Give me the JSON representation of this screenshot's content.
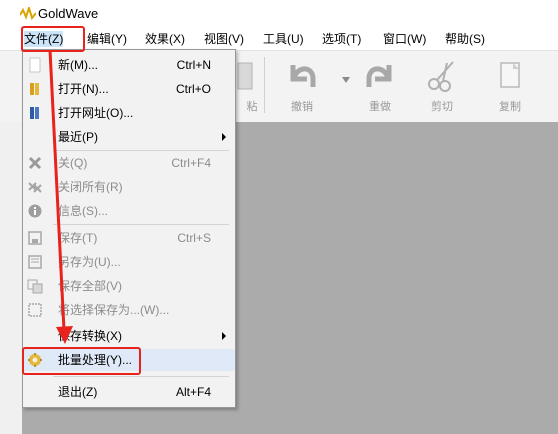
{
  "window": {
    "title": "GoldWave"
  },
  "menubar": {
    "items": [
      {
        "label": "文件(Z)"
      },
      {
        "label": "编辑(Y)"
      },
      {
        "label": "效果(X)"
      },
      {
        "label": "视图(V)"
      },
      {
        "label": "工具(U)"
      },
      {
        "label": "选项(T)"
      },
      {
        "label": "窗口(W)"
      },
      {
        "label": "帮助(S)"
      }
    ]
  },
  "toolbar": {
    "partial_label": "粘",
    "buttons": [
      {
        "label": "撤销",
        "icon": "undo-icon"
      },
      {
        "label": "重做",
        "icon": "redo-icon"
      },
      {
        "label": "剪切",
        "icon": "cut-icon"
      },
      {
        "label": "复制",
        "icon": "copy-icon"
      }
    ]
  },
  "file_menu": {
    "items": [
      {
        "label": "新(M)...",
        "shortcut": "Ctrl+N",
        "icon": "new-file-icon",
        "enabled": true
      },
      {
        "label": "打开(N)...",
        "shortcut": "Ctrl+O",
        "icon": "open-file-icon",
        "enabled": true
      },
      {
        "label": "打开网址(O)...",
        "shortcut": "",
        "icon": "open-url-icon",
        "enabled": true
      },
      {
        "label": "最近(P)",
        "shortcut": "",
        "submenu": true,
        "enabled": true
      },
      {
        "label": "关(Q)",
        "shortcut": "Ctrl+F4",
        "icon": "close-icon",
        "enabled": false
      },
      {
        "label": "关闭所有(R)",
        "shortcut": "",
        "icon": "close-all-icon",
        "enabled": false
      },
      {
        "label": "信息(S)...",
        "shortcut": "",
        "icon": "info-icon",
        "enabled": false
      },
      {
        "label": "保存(T)",
        "shortcut": "Ctrl+S",
        "icon": "save-icon",
        "enabled": false
      },
      {
        "label": "另存为(U)...",
        "shortcut": "",
        "icon": "save-as-icon",
        "enabled": false
      },
      {
        "label": "保存全部(V)",
        "shortcut": "",
        "icon": "save-all-icon",
        "enabled": false
      },
      {
        "label": "将选择保存为...(W)...",
        "shortcut": "",
        "icon": "save-selection-icon",
        "enabled": false
      },
      {
        "label": "保存转换(X)",
        "shortcut": "",
        "submenu": true,
        "enabled": true
      },
      {
        "label": "批量处理(Y)...",
        "shortcut": "",
        "icon": "batch-process-icon",
        "enabled": true
      },
      {
        "label": "退出(Z)",
        "shortcut": "Alt+F4",
        "enabled": true
      }
    ]
  },
  "colors": {
    "annotation": "#e8231d",
    "workspace": "#ababab",
    "menu_bg": "#f2f2f2"
  }
}
